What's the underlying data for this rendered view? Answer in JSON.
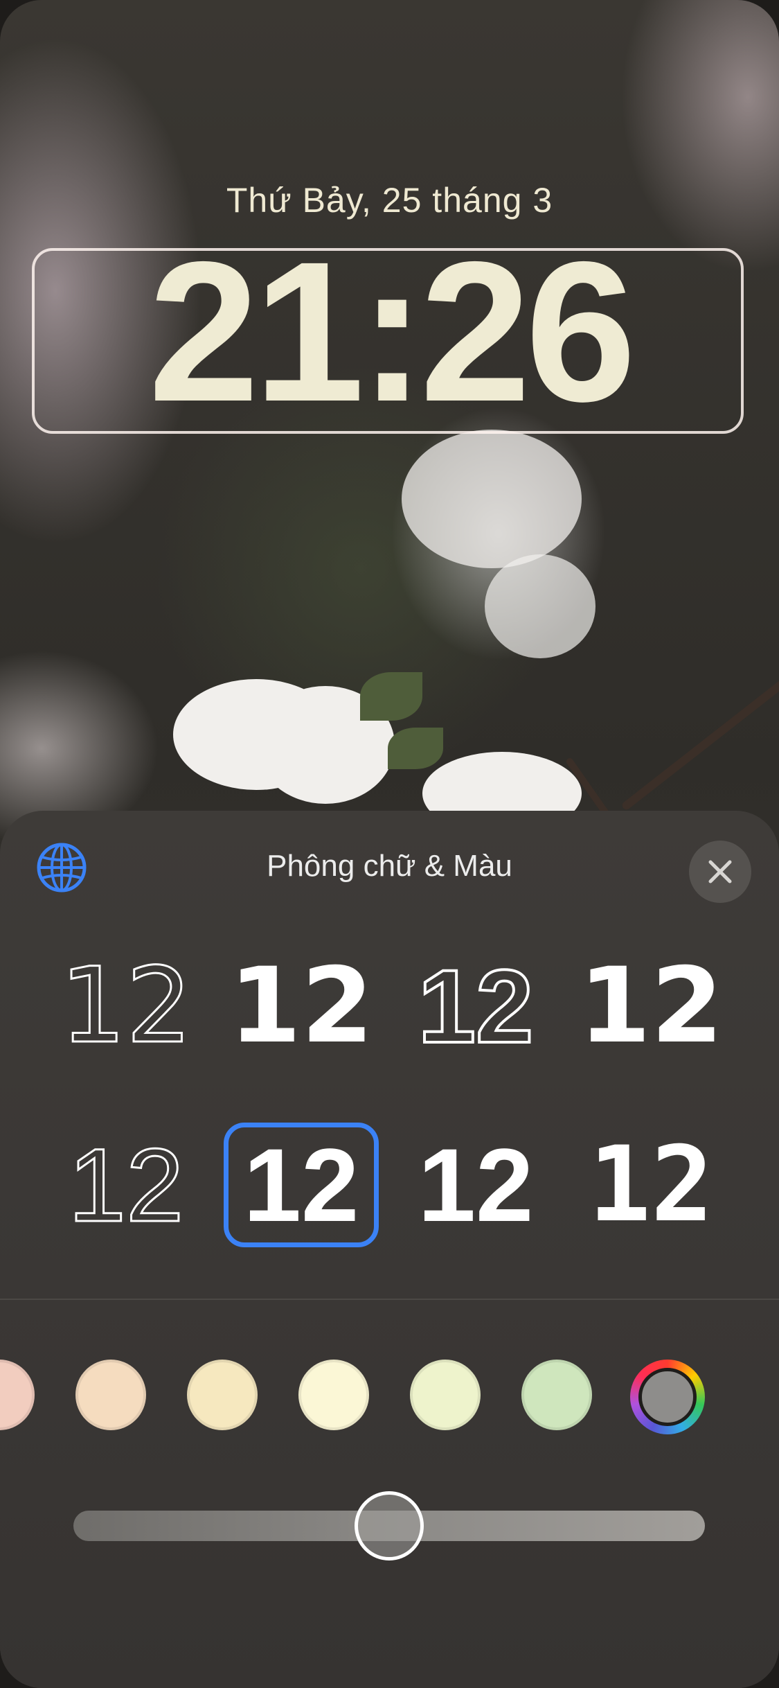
{
  "lock_screen": {
    "date": "Thứ Bảy, 25 tháng 3",
    "time": "21:26"
  },
  "sheet": {
    "title": "Phông chữ & Màu",
    "globe_icon": "globe-icon",
    "close_icon": "close-icon"
  },
  "fonts": {
    "sample": "12",
    "selected_index": 5
  },
  "colors": {
    "swatches": [
      "#f2cdbf",
      "#f5dcbf",
      "#f6e8bf",
      "#fbf7d6",
      "#eef3cc",
      "#cfe6bd"
    ],
    "accent": "#3b82f6"
  },
  "slider": {
    "value_fraction": 0.5
  }
}
